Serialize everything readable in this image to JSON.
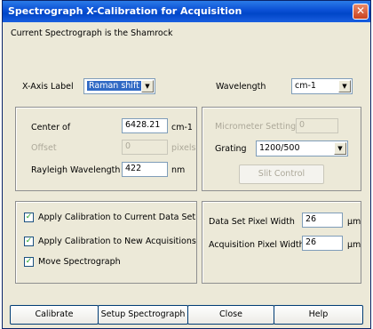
{
  "window": {
    "title": "Spectrograph X-Calibration for Acquisition",
    "close_glyph": "✕"
  },
  "current_spectrograph_text": "Current Spectrograph is the Shamrock",
  "axis": {
    "x_axis_label": "X-Axis Label",
    "x_axis_value": "Raman shift",
    "wavelength_label": "Wavelength",
    "wavelength_unit_value": "cm-1"
  },
  "left_panel": {
    "center_label": "Center of",
    "center_value": "6428.21",
    "center_unit": "cm-1",
    "offset_label": "Offset",
    "offset_value": "0",
    "offset_unit": "pixels",
    "rayleigh_label": "Rayleigh Wavelength",
    "rayleigh_value": "422",
    "rayleigh_unit": "nm"
  },
  "right_panel": {
    "micrometer_label": "Micrometer Setting",
    "micrometer_value": "0",
    "grating_label": "Grating",
    "grating_value": "1200/500",
    "slit_control_label": "Slit Control"
  },
  "options": {
    "apply_current": "Apply Calibration to Current Data Set",
    "apply_new": "Apply Calibration to New Acquisitions",
    "move_spectrograph": "Move Spectrograph",
    "check_glyph": "✓"
  },
  "pixel_width": {
    "data_set_label": "Data Set Pixel Width",
    "data_set_value": "26",
    "data_set_unit": "µm",
    "acquisition_label": "Acquisition Pixel Width",
    "acquisition_value": "26",
    "acquisition_unit": "µm"
  },
  "buttons": {
    "calibrate": "Calibrate",
    "setup": "Setup Spectrograph",
    "close": "Close",
    "help": "Help"
  },
  "dropdown_arrow": "▼"
}
